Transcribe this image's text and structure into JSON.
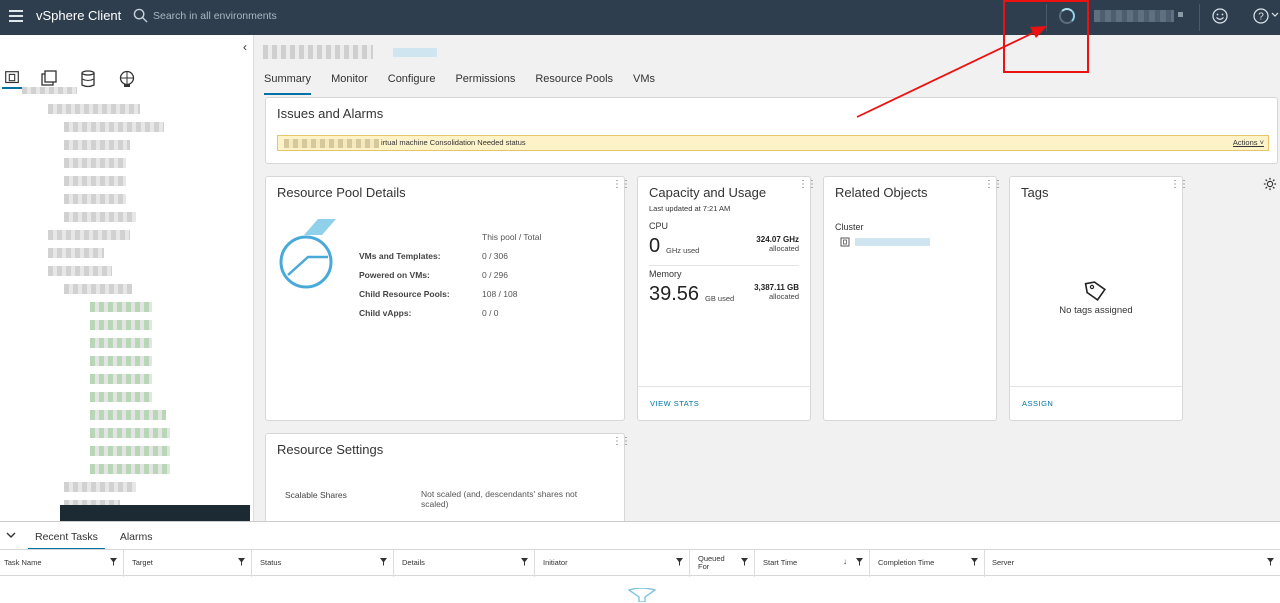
{
  "topbar": {
    "app_title": "vSphere Client",
    "search_placeholder": "Search in all environments"
  },
  "object_tabs": [
    "Summary",
    "Monitor",
    "Configure",
    "Permissions",
    "Resource Pools",
    "VMs"
  ],
  "issues": {
    "title": "Issues and Alarms",
    "alarm_text": "irtual machine Consolidation Needed status",
    "actions_label": "Actions"
  },
  "resource_pool": {
    "title": "Resource Pool Details",
    "header": "This pool / Total",
    "rows": [
      {
        "label": "VMs and Templates:",
        "value": "0 / 306"
      },
      {
        "label": "Powered on VMs:",
        "value": "0 / 296"
      },
      {
        "label": "Child Resource Pools:",
        "value": "108 / 108"
      },
      {
        "label": "Child vApps:",
        "value": "0 / 0"
      }
    ]
  },
  "capacity": {
    "title": "Capacity and Usage",
    "updated": "Last updated at 7:21 AM",
    "cpu_label": "CPU",
    "cpu_value": "0",
    "cpu_unit": "GHz used",
    "cpu_alloc": "324.07 GHz",
    "memory_label": "Memory",
    "memory_value": "39.56",
    "memory_unit": "GB used",
    "memory_alloc": "3,387.11 GB",
    "alloc_word": "allocated",
    "link": "VIEW STATS"
  },
  "related": {
    "title": "Related Objects",
    "cluster_label": "Cluster"
  },
  "tags": {
    "title": "Tags",
    "empty": "No tags assigned",
    "link": "ASSIGN"
  },
  "resource_settings": {
    "title": "Resource Settings",
    "label": "Scalable Shares",
    "value": "Not scaled (and, descendants' shares not scaled)"
  },
  "bottom": {
    "tabs": [
      "Recent Tasks",
      "Alarms"
    ],
    "columns": [
      "Task Name",
      "Target",
      "Status",
      "Details",
      "Initiator",
      "Queued For",
      "Start Time",
      "Completion Time",
      "Server"
    ]
  },
  "colors": {
    "topbar": "#2f3e4e",
    "accent": "#0072a3",
    "annotation": "#ee1111"
  }
}
